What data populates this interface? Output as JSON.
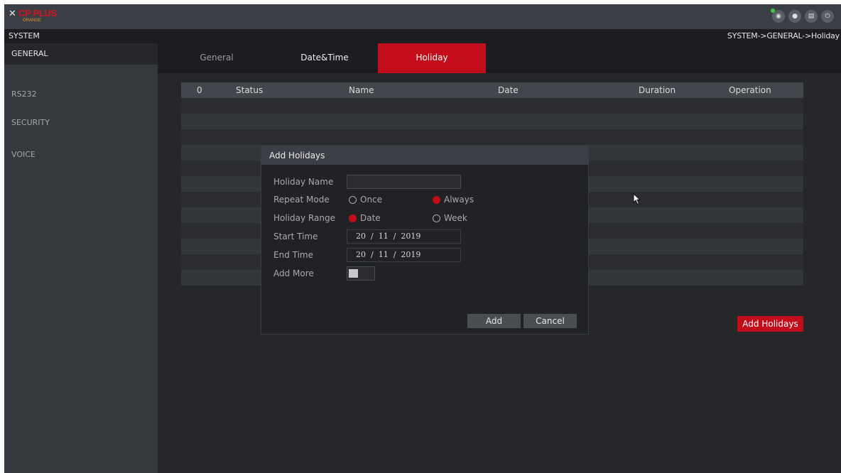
{
  "brand": {
    "logo_text": "CP PLUS",
    "logo_sub": "ORANGE",
    "logo_mark": "✕"
  },
  "header": {
    "icons": [
      "preview-icon",
      "user-icon",
      "display-icon",
      "power-icon"
    ],
    "icon_glyphs": [
      "◉",
      "●",
      "▤",
      "⏻"
    ]
  },
  "breadcrumb": {
    "section": "SYSTEM",
    "path": "SYSTEM->GENERAL->Holiday"
  },
  "sidebar": {
    "items": [
      {
        "label": "GENERAL"
      },
      {
        "label": "RS232"
      },
      {
        "label": "SECURITY"
      },
      {
        "label": "VOICE"
      }
    ]
  },
  "tabs": [
    {
      "label": "General"
    },
    {
      "label": "Date&Time"
    },
    {
      "label": "Holiday"
    }
  ],
  "table": {
    "columns": [
      "0",
      "Status",
      "Name",
      "Date",
      "Duration",
      "Operation"
    ]
  },
  "dialog": {
    "title": "Add Holidays",
    "labels": {
      "holiday_name": "Holiday Name",
      "repeat_mode": "Repeat Mode",
      "holiday_range": "Holiday Range",
      "start_time": "Start Time",
      "end_time": "End Time",
      "add_more": "Add More"
    },
    "holiday_name_value": "",
    "repeat_mode": {
      "options": [
        "Once",
        "Always"
      ],
      "selected": "Always"
    },
    "holiday_range": {
      "options": [
        "Date",
        "Week"
      ],
      "selected": "Date"
    },
    "start_time": {
      "day": "20",
      "month": "11",
      "year": "2019"
    },
    "end_time": {
      "day": "20",
      "month": "11",
      "year": "2019"
    },
    "add_more": false,
    "buttons": {
      "add": "Add",
      "cancel": "Cancel"
    }
  },
  "actions": {
    "add_holidays": "Add Holidays"
  },
  "colors": {
    "accent": "#c40d1b",
    "status_dot": "#3ccb3c"
  }
}
